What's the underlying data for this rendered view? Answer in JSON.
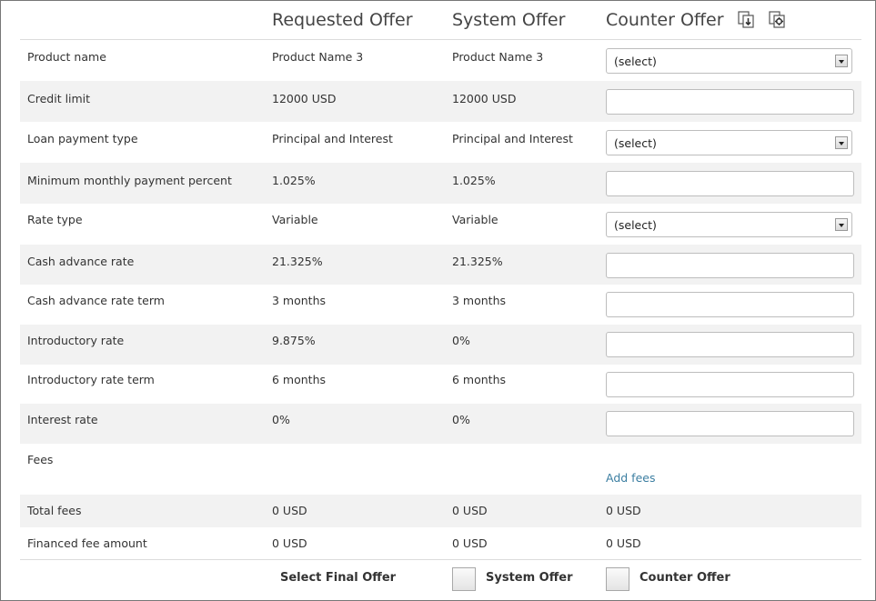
{
  "headers": {
    "requested": "Requested Offer",
    "system": "System Offer",
    "counter": "Counter Offer",
    "icons": [
      "copy-requested-icon",
      "copy-system-icon"
    ]
  },
  "rows": [
    {
      "label": "Product name",
      "requested": "Product Name 3",
      "system": "Product Name 3",
      "counter_type": "select",
      "counter_value": "(select)"
    },
    {
      "label": "Credit limit",
      "requested": "12000 USD",
      "system": "12000 USD",
      "counter_type": "input",
      "counter_value": ""
    },
    {
      "label": "Loan payment type",
      "requested": "Principal and Interest",
      "system": "Principal and Interest",
      "counter_type": "select",
      "counter_value": "(select)"
    },
    {
      "label": "Minimum monthly payment percent",
      "requested": "1.025%",
      "system": "1.025%",
      "counter_type": "input",
      "counter_value": ""
    },
    {
      "label": "Rate type",
      "requested": "Variable",
      "system": "Variable",
      "counter_type": "select",
      "counter_value": "(select)"
    },
    {
      "label": "Cash advance rate",
      "requested": "21.325%",
      "system": "21.325%",
      "counter_type": "input",
      "counter_value": ""
    },
    {
      "label": "Cash advance rate term",
      "requested": "3 months",
      "system": "3 months",
      "counter_type": "input",
      "counter_value": ""
    },
    {
      "label": "Introductory rate",
      "requested": "9.875%",
      "system": "0%",
      "counter_type": "input",
      "counter_value": ""
    },
    {
      "label": "Introductory rate term",
      "requested": "6 months",
      "system": "6 months",
      "counter_type": "input",
      "counter_value": ""
    },
    {
      "label": "Interest rate",
      "requested": "0%",
      "system": "0%",
      "counter_type": "input",
      "counter_value": ""
    }
  ],
  "fees": {
    "label": "Fees",
    "add_link": "Add fees"
  },
  "total_fees": {
    "label": "Total fees",
    "requested": "0 USD",
    "system": "0 USD",
    "counter": "0 USD"
  },
  "financed_fee": {
    "label": "Financed fee amount",
    "requested": "0 USD",
    "system": "0 USD",
    "counter": "0 USD"
  },
  "footer": {
    "select_final_label": "Select Final Offer",
    "system_option": "System Offer",
    "counter_option": "Counter Offer"
  }
}
